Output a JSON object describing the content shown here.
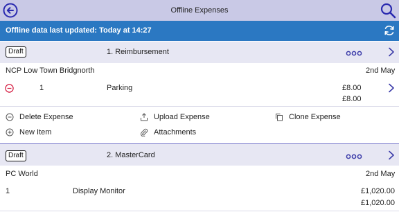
{
  "header": {
    "title": "Offline Expenses",
    "back_icon": "back-arrow-icon",
    "search_icon": "search-icon"
  },
  "banner": {
    "text": "Offline data last updated: Today at 14:27",
    "refresh_icon": "refresh-icon",
    "color": "#2b78c2"
  },
  "colors": {
    "accent": "#3a3aa8",
    "danger": "#d4183d",
    "header_bg": "#c9c9e6",
    "card_bg": "#e7e7f3"
  },
  "expenses": [
    {
      "status": "Draft",
      "title": "1. Reimbursement",
      "merchant": "NCP Low Town Bridgnorth",
      "date": "2nd May",
      "line": {
        "qty": "1",
        "description": "Parking",
        "amount": "£8.00",
        "total": "£8.00"
      }
    },
    {
      "status": "Draft",
      "title": "2. MasterCard",
      "merchant": "PC World",
      "date": "2nd May",
      "line": {
        "qty": "1",
        "description": "Display Monitor",
        "amount": "£1,020.00",
        "total": "£1,020.00"
      }
    }
  ],
  "actions": {
    "delete": "Delete Expense",
    "upload": "Upload Expense",
    "clone": "Clone Expense",
    "new_item": "New Item",
    "attachments": "Attachments"
  }
}
